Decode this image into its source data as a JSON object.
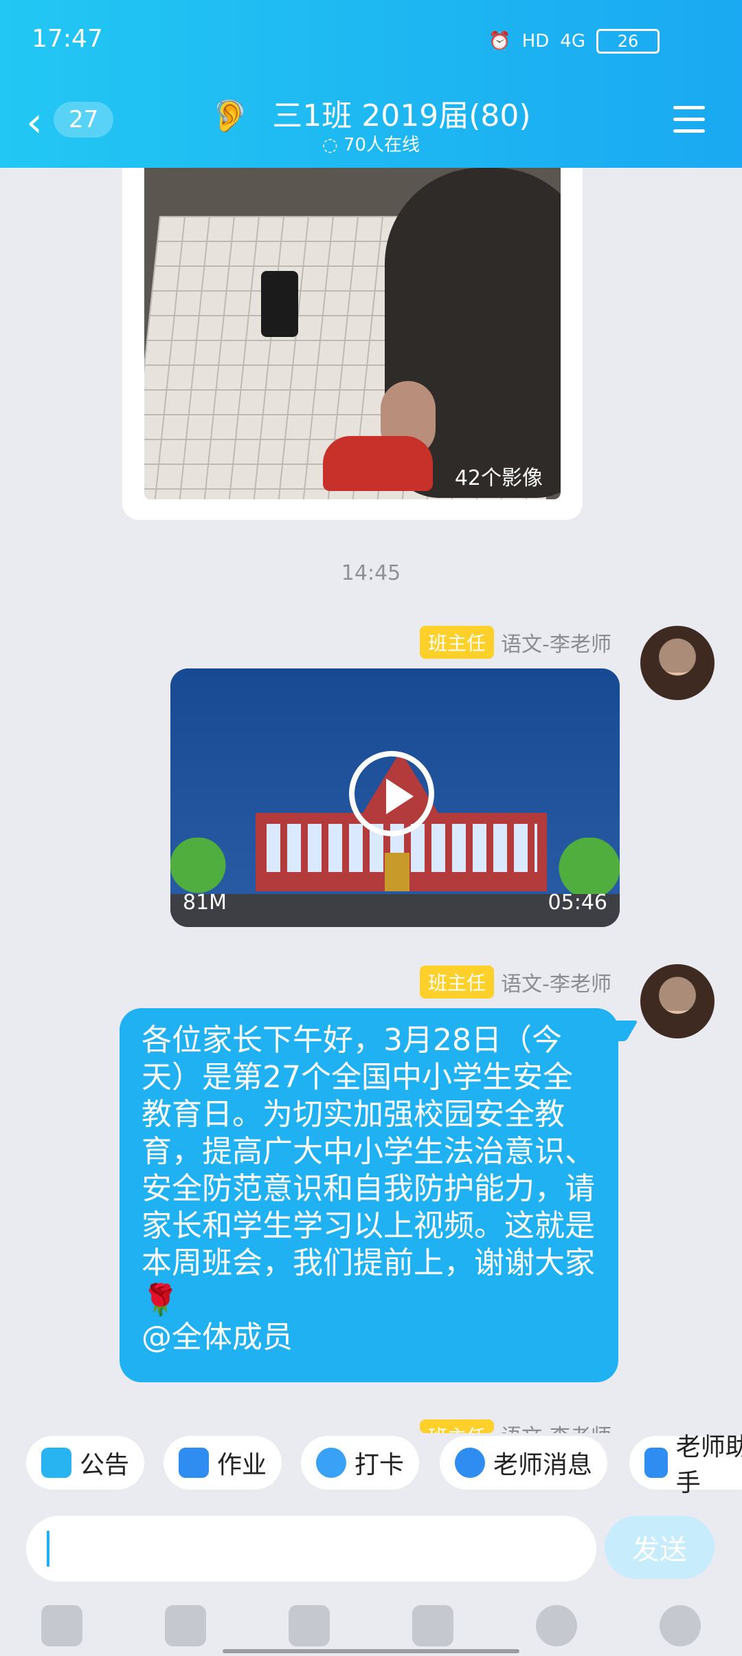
{
  "status_bar": {
    "time": "17:47",
    "battery": "26",
    "network": "4G",
    "hd": "HD"
  },
  "header": {
    "unread_count": "27",
    "title": "三1班  2019届(80)",
    "online": "70人在线"
  },
  "feed": {
    "photo_card": {
      "count_label": "42个影像"
    },
    "time_divider": "14:45",
    "messages": [
      {
        "badge": "班主任",
        "sender": "语文-李老师",
        "type": "video",
        "size": "81M",
        "duration": "05:46"
      },
      {
        "badge": "班主任",
        "sender": "语文-李老师",
        "type": "text",
        "text": "各位家长下午好，3月28日（今天）是第27个全国中小学生安全教育日。为切实加强校园安全教育，提高广大中小学生法治意识、安全防范意识和自我防护能力，请家长和学生学习以上视频。这就是本周班会，我们提前上，谢谢大家🌹\n@全体成员"
      },
      {
        "badge": "班主任",
        "sender": "语文-李老师"
      }
    ]
  },
  "quick_chips": [
    {
      "label": "公告",
      "icon": "megaphone-icon"
    },
    {
      "label": "作业",
      "icon": "document-icon"
    },
    {
      "label": "打卡",
      "icon": "checkmark-icon"
    },
    {
      "label": "老师消息",
      "icon": "teacher-icon"
    },
    {
      "label": "老师助手",
      "icon": "magnet-icon"
    }
  ],
  "composer": {
    "send_label": "发送"
  },
  "bottom_bar": [
    "mic-icon",
    "image-icon",
    "camera-icon",
    "folder-icon",
    "emoji-icon",
    "plus-icon"
  ]
}
